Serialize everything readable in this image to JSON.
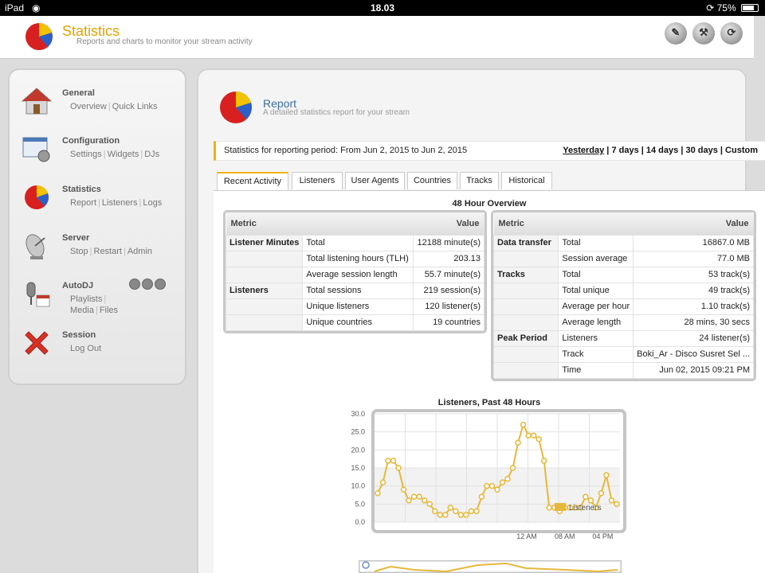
{
  "statusbar": {
    "device": "iPad",
    "time": "18.03",
    "battery": "75%",
    "battery_level": 0.75
  },
  "header": {
    "title": "Statistics",
    "subtitle": "Reports and charts to monitor your stream activity"
  },
  "sidebar": {
    "items": [
      {
        "title": "General",
        "links": [
          "Overview",
          "Quick Links"
        ]
      },
      {
        "title": "Configuration",
        "links": [
          "Settings",
          "Widgets",
          "DJs"
        ]
      },
      {
        "title": "Statistics",
        "links": [
          "Report",
          "Listeners",
          "Logs"
        ]
      },
      {
        "title": "Server",
        "links": [
          "Stop",
          "Restart",
          "Admin"
        ]
      },
      {
        "title": "AutoDJ",
        "links": [
          "Playlists",
          "Media",
          "Files"
        ]
      },
      {
        "title": "Session",
        "links": [
          "Log Out"
        ]
      }
    ]
  },
  "report": {
    "title": "Report",
    "subtitle": "A detailed statistics report for your stream"
  },
  "period": {
    "text": "Statistics for reporting period: From Jun 2, 2015 to Jun 2, 2015",
    "links": [
      "Yesterday",
      "7 days",
      "14 days",
      "30 days",
      "Custom"
    ],
    "active": "Yesterday"
  },
  "tabs": [
    "Recent Activity",
    "Listeners",
    "User Agents",
    "Countries",
    "Tracks",
    "Historical"
  ],
  "overview": {
    "title": "48 Hour Overview",
    "header": {
      "metric": "Metric",
      "value": "Value"
    },
    "left_table": [
      [
        "Listener Minutes",
        "Total",
        "12188 minute(s)"
      ],
      [
        "",
        "Total listening hours (TLH)",
        "203.13"
      ],
      [
        "",
        "Average session length",
        "55.7 minute(s)"
      ],
      [
        "Listeners",
        "Total sessions",
        "219 session(s)"
      ],
      [
        "",
        "Unique listeners",
        "120 listener(s)"
      ],
      [
        "",
        "Unique countries",
        "19 countries"
      ]
    ],
    "right_table": [
      [
        "Data transfer",
        "Total",
        "16867.0 MB"
      ],
      [
        "",
        "Session average",
        "77.0 MB"
      ],
      [
        "Tracks",
        "Total",
        "53 track(s)"
      ],
      [
        "",
        "Total unique",
        "49 track(s)"
      ],
      [
        "",
        "Average per hour",
        "1.10 track(s)"
      ],
      [
        "",
        "Average length",
        "28 mins, 30 secs"
      ],
      [
        "Peak Period",
        "Listeners",
        "24 listener(s)"
      ],
      [
        "",
        "Track",
        "Boki_Ar - Disco Susret Sel ..."
      ],
      [
        "",
        "Time",
        "Jun 02, 2015 09:21 PM"
      ]
    ]
  },
  "chart_data": {
    "type": "line",
    "title": "Listeners, Past 48 Hours",
    "xlabel": "",
    "ylabel": "",
    "ylim": [
      0,
      30
    ],
    "yticks": [
      "0.0",
      "5.0",
      "10.0",
      "15.0",
      "20.0",
      "25.0",
      "30.0"
    ],
    "xticks": [
      "12 AM",
      "08 AM",
      "04 PM"
    ],
    "legend": "Listeners",
    "legend_position": "bottom-right",
    "grid": true,
    "color": "#e6b83a",
    "series": [
      {
        "name": "Listeners",
        "values": [
          8,
          11,
          17,
          17,
          15,
          9,
          6,
          7,
          7,
          6,
          5,
          3,
          2,
          2,
          4,
          3,
          2,
          2,
          3,
          3,
          7,
          10,
          10,
          9,
          11,
          12,
          15,
          22,
          27,
          24,
          24,
          23,
          17,
          4,
          4,
          3,
          4,
          4,
          4,
          4,
          7,
          6,
          4,
          8,
          13,
          6,
          5
        ]
      }
    ]
  }
}
